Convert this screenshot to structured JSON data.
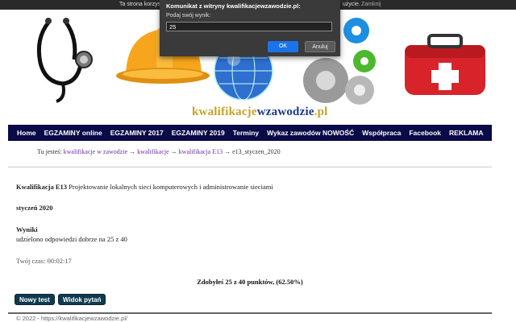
{
  "cookie_bar": {
    "text_start": "Ta strona korzyst",
    "text_end": "użycie.",
    "close_label": "Zamknij"
  },
  "header": {
    "logo_part1": "kwalifikacje",
    "logo_part2": "wzawodzie",
    "logo_part3": ".pl"
  },
  "nav": {
    "items": [
      "Home",
      "EGZAMINY online",
      "EGZAMINY 2017",
      "EGZAMINY 2019",
      "Terminy",
      "Wykaz zawodów NOWOŚĆ",
      "Współpraca",
      "Facebook",
      "REKLAMA"
    ]
  },
  "breadcrumb": {
    "prefix": "Tu jesteś:",
    "links": [
      "kwalifikacje w zawodzie",
      "kwalifikacje",
      "kwalifikacja E13"
    ],
    "separator": "→",
    "current": "e13_styczen_2020"
  },
  "content": {
    "qual_label": "Kwalifikacja E13",
    "qual_desc": "Projektowanie lokalnych sieci komputerowych i administrowanie sieciami",
    "date": "styczeń 2020",
    "results_heading": "Wyniki",
    "results_text": "udzielono odpowiedzi dobrze na 25 z 40",
    "time_text": "Twój czas: 00:02:17",
    "score_text": "Zdobyłeś 25 z 40 punktów, (62.50%)",
    "new_test_label": "Nowy test",
    "view_questions_label": "Widok pytań"
  },
  "footer": {
    "text": "© 2022 - https://kwalifikacjewzawodzie.pl/"
  },
  "dialog": {
    "title": "Komunikat z witryny kwalifikacjewzawodzie.pl:",
    "prompt": "Podaj swój wynik:",
    "input_value": "25",
    "ok_label": "OK",
    "cancel_label": "Anuluj"
  },
  "colors": {
    "nav_bg": "#0a0a48",
    "button_bg": "#0f3a4e",
    "dialog_bg": "#3a3a3a",
    "ok_blue": "#1a73e8",
    "logo_gold": "#c9a227",
    "logo_blue": "#1a3a8a"
  }
}
